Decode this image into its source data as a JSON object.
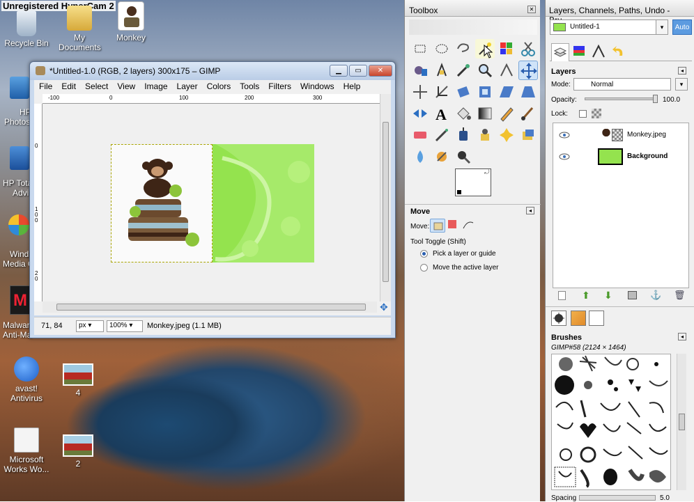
{
  "recorder_watermark": "Unregistered HyperCam 2",
  "desktop": {
    "icons": [
      {
        "label": "Recycle Bin",
        "icon": "recycle-bin-icon"
      },
      {
        "label": "My Documents",
        "icon": "folder-icon"
      },
      {
        "label": "Monkey",
        "icon": "image-file-icon"
      },
      {
        "label": "avast! Antivirus",
        "icon": "avast-icon"
      },
      {
        "label": "4",
        "icon": "photo-file-icon"
      },
      {
        "label": "Microsoft Works Wo...",
        "icon": "works-icon"
      },
      {
        "label": "2",
        "icon": "photo-file-icon"
      }
    ],
    "partial_labels": [
      "HP",
      "Photos",
      "HP Tota",
      "Advi",
      "Wind",
      "Media C",
      "Malwar",
      "Anti-Ma"
    ]
  },
  "image_window": {
    "title": "*Untitled-1.0 (RGB, 2 layers) 300x175 – GIMP",
    "menu": [
      "File",
      "Edit",
      "Select",
      "View",
      "Image",
      "Layer",
      "Colors",
      "Tools",
      "Filters",
      "Windows",
      "Help"
    ],
    "ruler_h": [
      "-100",
      "0",
      "100",
      "200",
      "300"
    ],
    "ruler_v": [
      "0",
      "1\n0\n0",
      "2\n0"
    ],
    "status": {
      "coords": "71, 84",
      "unit": "px",
      "zoom": "100%",
      "message": "Monkey.jpeg (1.1 MB)"
    }
  },
  "toolbox": {
    "title": "Toolbox",
    "move_section": {
      "title": "Move",
      "move_label": "Move:",
      "toggle_label": "Tool Toggle  (Shift)",
      "options": [
        "Pick a layer or guide",
        "Move the active layer"
      ]
    }
  },
  "layers_dock": {
    "title": "Layers, Channels, Paths, Undo - Bru...",
    "image_select": "Untitled-1",
    "auto_label": "Auto",
    "layers_title": "Layers",
    "mode_label": "Mode:",
    "mode_value": "Normal",
    "opacity_label": "Opacity:",
    "opacity_value": "100.0",
    "lock_label": "Lock:",
    "layers": [
      {
        "name": "Monkey.jpeg",
        "bold": false
      },
      {
        "name": "Background",
        "bold": true
      }
    ],
    "brushes_title": "Brushes",
    "brush_name": "GIMP#58 (2124 × 1464)",
    "spacing_label": "Spacing",
    "spacing_value": "5.0"
  },
  "colors": {
    "titlebar": "#c9d9ee",
    "canvas_green": "#94e34e",
    "selection_blue": "#cfe3f8",
    "accent": "#5c9be0"
  }
}
